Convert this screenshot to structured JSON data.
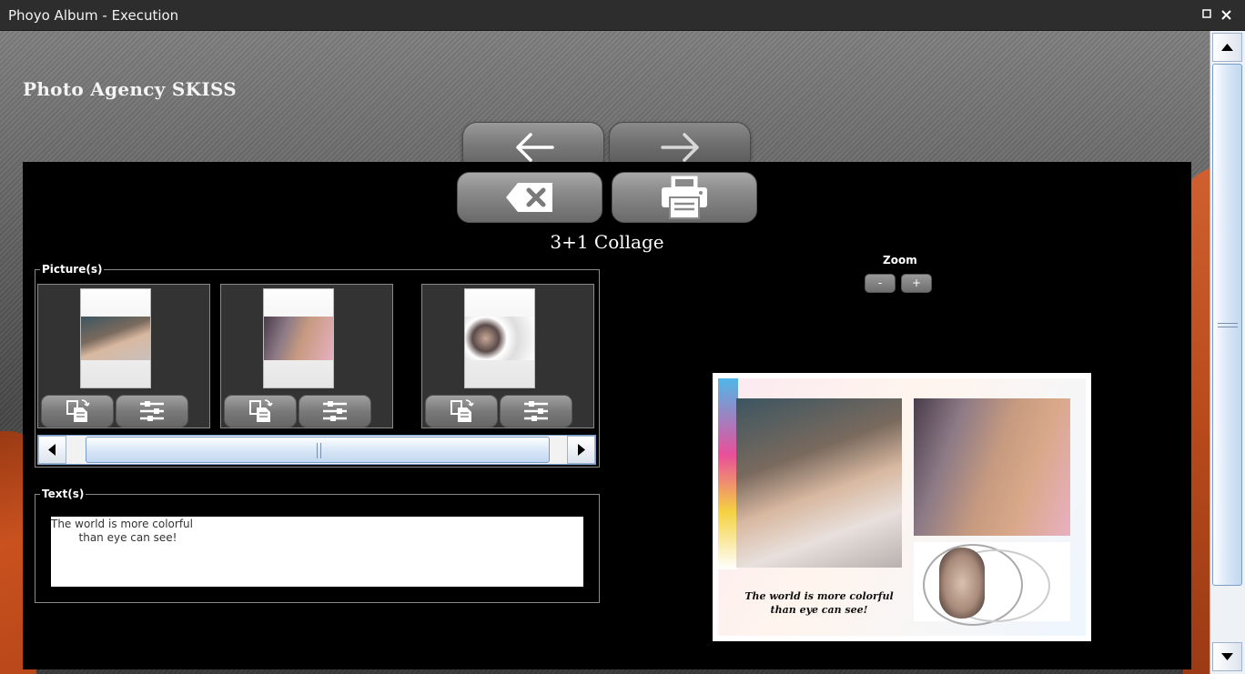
{
  "window": {
    "title": "Phoyo Album - Execution",
    "maximize_icon": "maximize-icon",
    "close_icon": "close-icon"
  },
  "app": {
    "title": "Photo Agency SKISS"
  },
  "nav": {
    "back_icon": "arrow-left-icon",
    "forward_icon": "arrow-right-icon"
  },
  "toolbar": {
    "delete_icon": "backspace-icon",
    "print_icon": "printer-icon"
  },
  "collage": {
    "title": "3+1 Collage"
  },
  "pictures": {
    "legend": "Picture(s)",
    "items": [
      {
        "name": "family-photo"
      },
      {
        "name": "girl-portrait"
      },
      {
        "name": "woman-tech-icons"
      }
    ],
    "replace_icon": "replace-file-icon",
    "adjust_icon": "sliders-icon"
  },
  "texts": {
    "legend": "Text(s)",
    "value": "The world is more colorful\n        than eye can see!"
  },
  "zoom": {
    "label": "Zoom",
    "minus": "-",
    "plus": "+"
  },
  "preview": {
    "caption": "The world is more colorful\nthan eye can see!"
  },
  "colors": {
    "accent_orange": "#c9511f",
    "panel_bg": "#000000",
    "scroll_blue": "#c2d7f0"
  }
}
